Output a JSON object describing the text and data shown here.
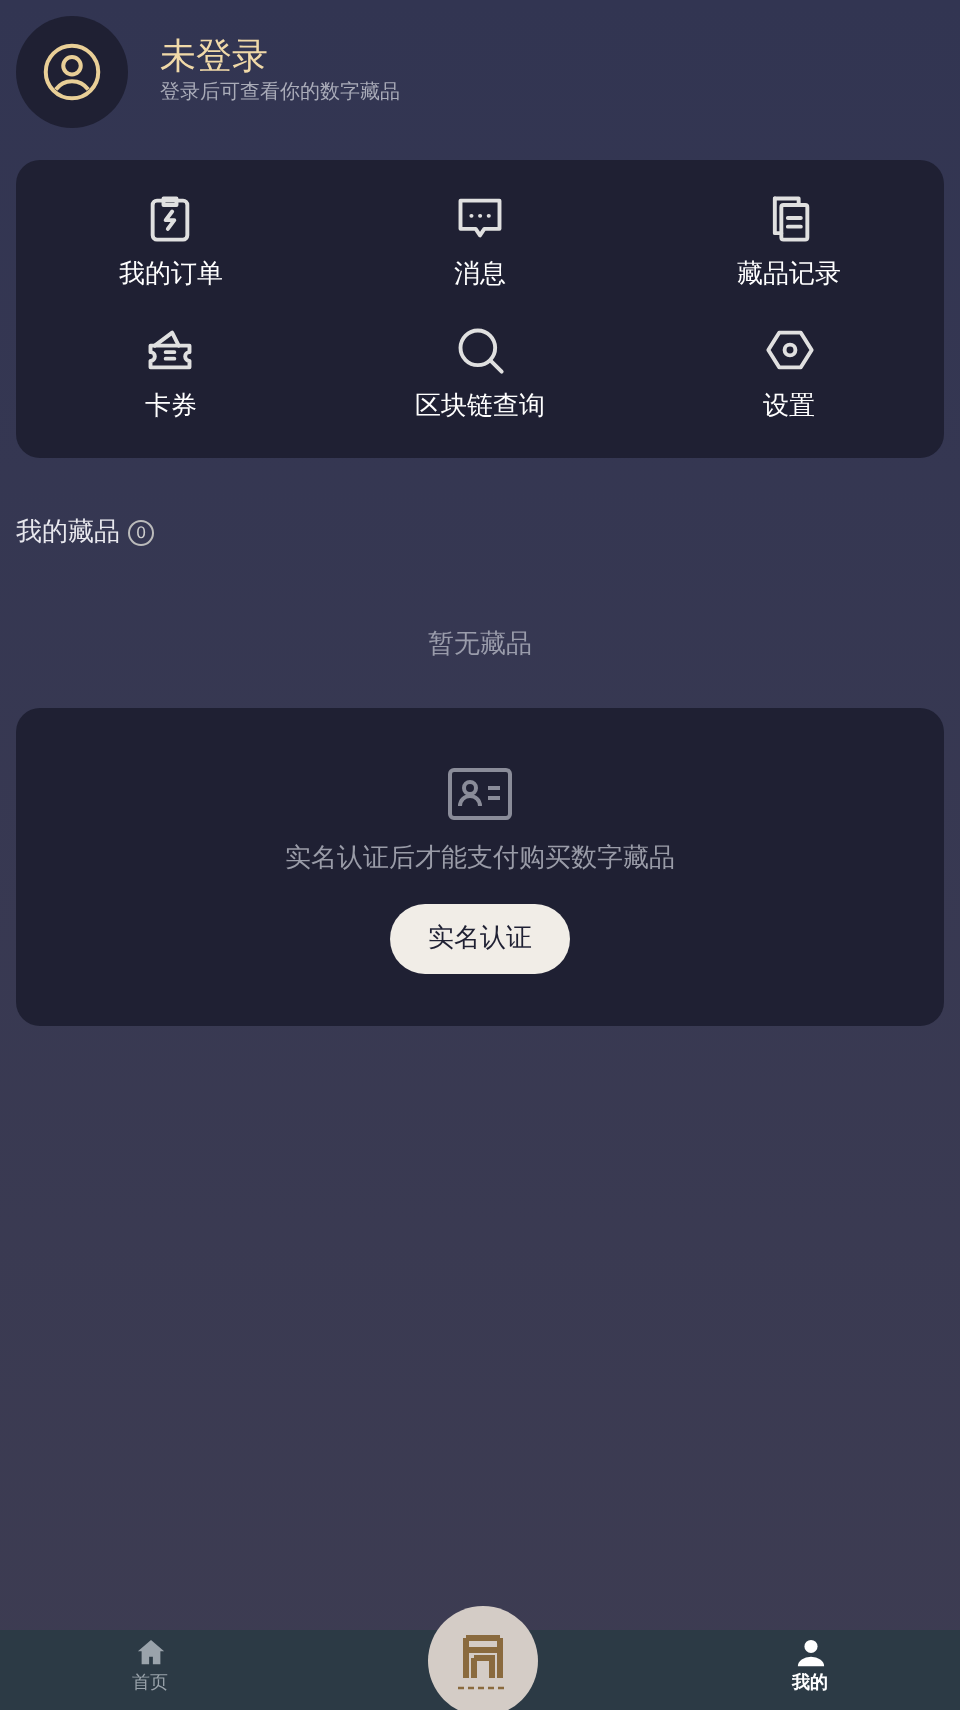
{
  "profile": {
    "name": "未登录",
    "subtitle": "登录后可查看你的数字藏品"
  },
  "menu": [
    {
      "label": "我的订单",
      "kind": "order"
    },
    {
      "label": "消息",
      "kind": "message"
    },
    {
      "label": "藏品记录",
      "kind": "records"
    },
    {
      "label": "卡券",
      "kind": "coupon"
    },
    {
      "label": "区块链查询",
      "kind": "search"
    },
    {
      "label": "设置",
      "kind": "settings"
    }
  ],
  "collection": {
    "title": "我的藏品",
    "count": "0",
    "empty_text": "暂无藏品"
  },
  "verify": {
    "text": "实名认证后才能支付购买数字藏品",
    "button": "实名认证"
  },
  "tab_bar": [
    {
      "label": "首页",
      "kind": "home",
      "selected": false
    },
    {
      "kind": "logo"
    },
    {
      "label": "我的",
      "kind": "user",
      "selected": true
    }
  ]
}
